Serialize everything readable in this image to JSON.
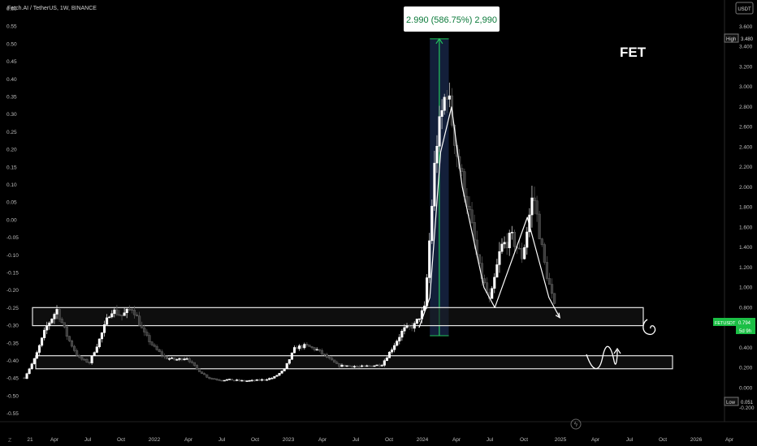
{
  "header": {
    "symbol_title": "Fetch.AI / TetherUS, 1W, BINANCE",
    "currency": "USDT"
  },
  "colors": {
    "background": "#000000",
    "bull": "#ffffff",
    "bear": "#3a3a3a",
    "range_fill": "#1b2c52",
    "measure_green": "#22c55e",
    "price_badge": "#1bbf45",
    "zone_border": "#e6e6e6",
    "zone_fill": "#1a1a1a"
  },
  "annotation": {
    "ticker_text": "FET",
    "measure_label": "2.990 (586.75%) 2,990"
  },
  "left_axis": {
    "ticks": [
      "0.60",
      "0.55",
      "0.50",
      "0.45",
      "0.40",
      "0.35",
      "0.30",
      "0.25",
      "0.20",
      "0.15",
      "0.10",
      "0.05",
      "0.00",
      "-0.05",
      "-0.10",
      "-0.15",
      "-0.20",
      "-0.25",
      "-0.30",
      "-0.35",
      "-0.40",
      "-0.45",
      "-0.50",
      "-0.55"
    ]
  },
  "right_axis": {
    "ticks": [
      "3.600",
      "3.400",
      "3.200",
      "3.000",
      "2.800",
      "2.600",
      "2.400",
      "2.200",
      "2.000",
      "1.800",
      "1.600",
      "1.400",
      "1.200",
      "1.000",
      "0.800",
      "0.600",
      "0.400",
      "0.200",
      "0.000",
      "-0.200"
    ],
    "high_label": "High",
    "high_value": "3.480",
    "low_label": "Low",
    "low_value": "0.051",
    "last_symbol": "FETUSDT",
    "last_value": "0.794",
    "countdown": "5d 9h"
  },
  "time_axis": {
    "ticks": [
      "21",
      "Apr",
      "Jul",
      "Oct",
      "2022",
      "Apr",
      "Jul",
      "Oct",
      "2023",
      "Apr",
      "Jul",
      "Oct",
      "2024",
      "Apr",
      "Jul",
      "Oct",
      "2025",
      "Apr",
      "Jul",
      "Oct",
      "2026",
      "Apr"
    ]
  },
  "chart_data": {
    "type": "candlestick",
    "title": "Fetch.AI / TetherUS, 1W, BINANCE",
    "y_unit": "USDT",
    "ylim": [
      -0.2,
      3.7
    ],
    "x_range": [
      "2021-01",
      "2026-05"
    ],
    "interval": "1W",
    "high": 3.48,
    "low": 0.051,
    "last_price": 0.794,
    "path_points": [
      [
        "2021-01",
        0.1
      ],
      [
        "2021-02",
        0.3
      ],
      [
        "2021-03",
        0.6
      ],
      [
        "2021-04",
        0.78
      ],
      [
        "2021-05",
        0.5
      ],
      [
        "2021-06",
        0.3
      ],
      [
        "2021-07",
        0.25
      ],
      [
        "2021-08",
        0.5
      ],
      [
        "2021-09",
        0.78
      ],
      [
        "2021-10",
        0.72
      ],
      [
        "2021-11",
        0.8
      ],
      [
        "2021-12",
        0.55
      ],
      [
        "2022-01",
        0.4
      ],
      [
        "2022-02",
        0.3
      ],
      [
        "2022-03",
        0.28
      ],
      [
        "2022-04",
        0.3
      ],
      [
        "2022-05",
        0.18
      ],
      [
        "2022-06",
        0.1
      ],
      [
        "2022-07",
        0.08
      ],
      [
        "2022-08",
        0.08
      ],
      [
        "2022-09",
        0.07
      ],
      [
        "2022-10",
        0.07
      ],
      [
        "2022-11",
        0.08
      ],
      [
        "2022-12",
        0.1
      ],
      [
        "2023-01",
        0.18
      ],
      [
        "2023-02",
        0.4
      ],
      [
        "2023-03",
        0.42
      ],
      [
        "2023-04",
        0.38
      ],
      [
        "2023-05",
        0.3
      ],
      [
        "2023-06",
        0.22
      ],
      [
        "2023-07",
        0.22
      ],
      [
        "2023-08",
        0.21
      ],
      [
        "2023-09",
        0.22
      ],
      [
        "2023-10",
        0.23
      ],
      [
        "2023-11",
        0.4
      ],
      [
        "2023-12",
        0.58
      ],
      [
        "2024-01",
        0.62
      ],
      [
        "2024-02",
        0.8
      ],
      [
        "2024-03",
        2.4
      ],
      [
        "2024-04",
        3.0
      ],
      [
        "2024-05",
        2.3
      ],
      [
        "2024-06",
        1.8
      ],
      [
        "2024-07",
        1.2
      ],
      [
        "2024-08",
        0.85
      ],
      [
        "2024-09",
        1.4
      ],
      [
        "2024-10",
        1.5
      ],
      [
        "2024-11",
        1.3
      ],
      [
        "2024-12",
        1.95
      ],
      [
        "2025-01",
        1.25
      ],
      [
        "2025-02",
        0.79
      ]
    ],
    "measure": {
      "from": 0.52,
      "to": 3.48,
      "change": "2.990 (586.75%) 2,990"
    },
    "zones": [
      {
        "low": 0.62,
        "high": 0.8
      },
      {
        "low": 0.19,
        "high": 0.32
      }
    ],
    "overlay_path": [
      [
        "2024-01",
        0.6
      ],
      [
        "2024-02",
        0.9
      ],
      [
        "2024-03",
        2.35
      ],
      [
        "2024-04",
        2.8
      ],
      [
        "2024-05",
        2.0
      ],
      [
        "2024-06",
        1.5
      ],
      [
        "2024-07",
        1.0
      ],
      [
        "2024-08",
        0.8
      ],
      [
        "2024-09",
        1.1
      ],
      [
        "2024-10",
        1.4
      ],
      [
        "2024-11",
        1.7
      ],
      [
        "2024-12",
        1.3
      ],
      [
        "2025-01",
        0.9
      ],
      [
        "2025-02",
        0.7
      ]
    ],
    "grid": false,
    "legend": "none"
  }
}
